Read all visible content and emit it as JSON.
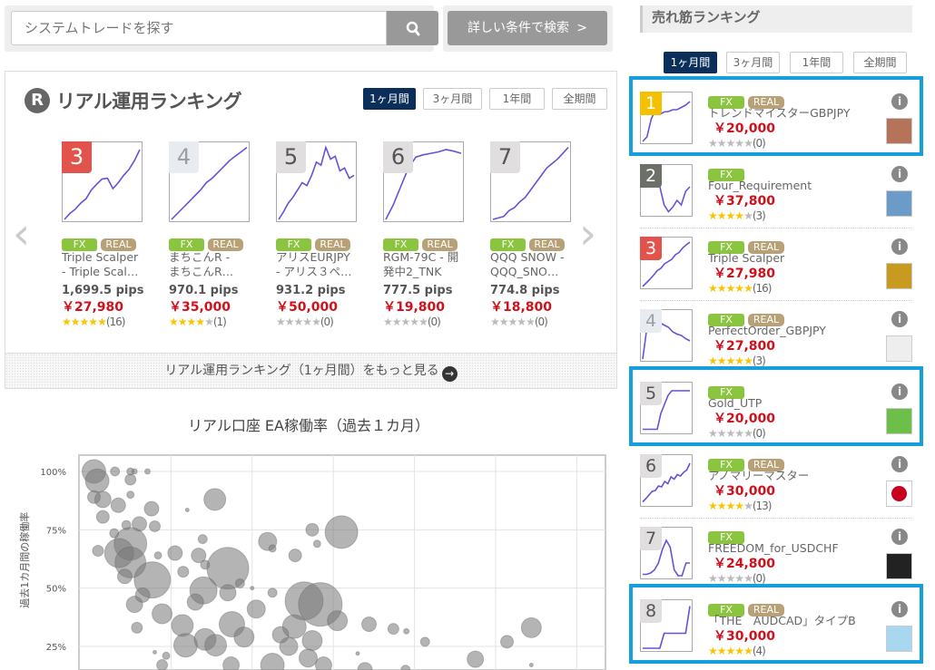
{
  "search": {
    "placeholder": "システムトレードを探す",
    "button_icon": "search-icon",
    "advanced_label": "詳しい条件で検索",
    "advanced_arrow": ">"
  },
  "real_ranking": {
    "icon_letter": "R",
    "title": "リアル運用ランキング",
    "tabs": [
      {
        "label": "1ヶ月間",
        "active": true
      },
      {
        "label": "3ヶ月間"
      },
      {
        "label": "1年間"
      },
      {
        "label": "全期間"
      }
    ],
    "cards": [
      {
        "rank": "3",
        "fx": "FX",
        "real": "REAL",
        "name1": "Triple Scalper",
        "name2": "- Triple Scal…",
        "pips": "1,699.5 pips",
        "price": "￥27,980",
        "rating": 4.5,
        "reviews": "(16)",
        "rank_color": "#e2534b",
        "rank_text": "#fff",
        "sparkline": [
          0,
          8,
          14,
          22,
          28,
          40,
          48,
          55,
          56,
          42,
          50,
          60,
          68,
          80,
          95
        ]
      },
      {
        "rank": "4",
        "fx": "FX",
        "real": "REAL",
        "name1": "まちこんR -",
        "name2": "まちこんR…",
        "pips": "970.1 pips",
        "price": "￥35,000",
        "rating": 4,
        "reviews": "(1)",
        "rank_color": "#e8ebef",
        "rank_text": "#9aa0a8",
        "sparkline": [
          0,
          8,
          16,
          24,
          32,
          40,
          50,
          56,
          64,
          72,
          80,
          86,
          92,
          98
        ]
      },
      {
        "rank": "5",
        "fx": "FX",
        "real": "REAL",
        "name1": "アリスEURJPY",
        "name2": "- アリス３ペ…",
        "pips": "931.2 pips",
        "price": "￥50,000",
        "rating": 0,
        "reviews": "(0)",
        "rank_color": "#e0dede",
        "rank_text": "#555",
        "sparkline": [
          0,
          10,
          22,
          30,
          40,
          50,
          46,
          60,
          78,
          74,
          98,
          82,
          86,
          66,
          70,
          56,
          60
        ]
      },
      {
        "rank": "6",
        "fx": "FX",
        "real": "REAL",
        "name1": "RGM-79C - 開",
        "name2": "発中2_TNK",
        "pips": "777.5 pips",
        "price": "￥19,800",
        "rating": 0,
        "reviews": "(0)",
        "rank_color": "#e0dede",
        "rank_text": "#555",
        "sparkline": [
          0,
          20,
          45,
          70,
          85,
          88,
          90,
          92,
          95,
          93,
          90
        ]
      },
      {
        "rank": "7",
        "fx": "FX",
        "real": "REAL",
        "name1": "QQQ SNOW -",
        "name2": "QQQ_SNO…",
        "pips": "774.8 pips",
        "price": "￥18,800",
        "rating": 0,
        "reviews": "(0)",
        "rank_color": "#e0dede",
        "rank_text": "#555",
        "sparkline": [
          0,
          2,
          4,
          12,
          16,
          24,
          30,
          40,
          50,
          60,
          70,
          76,
          82,
          90,
          98
        ]
      }
    ],
    "prev_arrow": "‹",
    "next_arrow": "›",
    "more_link": "リアル運用ランキング（1ヶ月間）をもっと見る",
    "more_icon": "→"
  },
  "sales_ranking": {
    "title": "売れ筋ランキング",
    "tabs": [
      {
        "label": "1ヶ月間",
        "active": true
      },
      {
        "label": "3ヶ月間"
      },
      {
        "label": "1年間"
      },
      {
        "label": "全期間"
      }
    ],
    "info_label": "i",
    "items": [
      {
        "rank": "1",
        "fx": "FX",
        "real": "REAL",
        "name": "トレンドマイスターGBPJPY",
        "price": "￥20,000",
        "rating": 0,
        "reviews": "(0)",
        "highlighted": true,
        "rank_color": "#f5c000",
        "rank_text": "#fff",
        "img_color": "#b5735a",
        "sparkline": [
          0,
          10,
          50,
          70,
          60,
          65,
          66,
          70,
          70,
          75,
          80,
          88
        ]
      },
      {
        "rank": "2",
        "fx": "FX",
        "real": "",
        "name": "Four_Requirement",
        "price": "￥37,800",
        "rating": 3.5,
        "reviews": "(3)",
        "highlighted": false,
        "rank_color": "#6d7069",
        "rank_text": "#fff",
        "img_color": "#6b9bc8",
        "sparkline": [
          95,
          80,
          72,
          78,
          60,
          20,
          5,
          15,
          30,
          20,
          50,
          60
        ]
      },
      {
        "rank": "3",
        "fx": "FX",
        "real": "REAL",
        "name": "Triple Scalper",
        "price": "￥27,980",
        "rating": 4.5,
        "reviews": "(16)",
        "highlighted": false,
        "rank_color": "#e2534b",
        "rank_text": "#fff",
        "img_color": "#c89a20",
        "sparkline": [
          0,
          8,
          16,
          25,
          35,
          40,
          50,
          55,
          60,
          70,
          75,
          85,
          92,
          98
        ]
      },
      {
        "rank": "4",
        "fx": "FX",
        "real": "REAL",
        "name": "PerfectOrder_GBPJPY",
        "price": "￥27,800",
        "rating": 5,
        "reviews": "(3)",
        "highlighted": false,
        "rank_color": "#e8ebef",
        "rank_text": "#9aa0a8",
        "img_color": "#eeeeee",
        "sparkline": [
          0,
          70,
          70,
          95,
          80,
          75,
          70,
          60,
          55,
          52,
          45,
          40
        ]
      },
      {
        "rank": "5",
        "fx": "FX",
        "real": "",
        "name": "Gold_UTP",
        "price": "￥20,000",
        "rating": 0,
        "reviews": "(0)",
        "highlighted": true,
        "rank_color": "#e0dede",
        "rank_text": "#555",
        "img_color": "#6cc04a",
        "sparkline": [
          5,
          5,
          5,
          5,
          5,
          40,
          60,
          80,
          90,
          90,
          90,
          90,
          90,
          90
        ]
      },
      {
        "rank": "6",
        "fx": "FX",
        "real": "REAL",
        "name": "アノマリーマスター",
        "price": "￥30,000",
        "rating": 4,
        "reviews": "(13)",
        "highlighted": false,
        "rank_color": "#e0dede",
        "rank_text": "#555",
        "img_color": "#ffffff",
        "sparkline": [
          5,
          12,
          20,
          28,
          30,
          40,
          38,
          50,
          45,
          60,
          55,
          65,
          62,
          70,
          75,
          90
        ]
      },
      {
        "rank": "7",
        "fx": "FX",
        "real": "",
        "name": "FREEDOM_for_USDCHF",
        "price": "￥24,800",
        "rating": 0,
        "reviews": "(0)",
        "highlighted": false,
        "rank_color": "#e0dede",
        "rank_text": "#555",
        "img_color": "#222222",
        "sparkline": [
          5,
          5,
          8,
          15,
          30,
          60,
          80,
          65,
          15,
          2,
          2,
          30,
          30
        ]
      },
      {
        "rank": "8",
        "fx": "FX",
        "real": "REAL",
        "name": "「THE　AUDCAD」タイプB",
        "price": "￥30,000",
        "rating": 5,
        "reviews": "(4)",
        "highlighted": true,
        "rank_color": "#e0dede",
        "rank_text": "#555",
        "img_color": "#a8d8f0",
        "sparkline": [
          2,
          2,
          2,
          2,
          2,
          35,
          35,
          35,
          35,
          35,
          35,
          95
        ]
      }
    ]
  },
  "chart_data": {
    "type": "scatter",
    "subtype": "bubble",
    "title": "リアル口座 EA稼働率（過去１カ月）",
    "xlabel": "",
    "ylabel": "過去1カ月間の稼働率",
    "yticks": [
      "100%",
      "75%",
      "50%",
      "25%"
    ],
    "ytick_values": [
      100,
      75,
      50,
      25
    ],
    "grid": true,
    "xlim": [
      0,
      6.3
    ],
    "ylim_visible": [
      13,
      107
    ],
    "color": "#777777",
    "bubbles": [
      [
        0.05,
        100,
        13
      ],
      [
        0.09,
        96,
        13
      ],
      [
        0.31,
        100,
        5
      ],
      [
        0.5,
        100,
        4
      ],
      [
        0.55,
        100,
        3
      ],
      [
        0.71,
        100,
        3
      ],
      [
        0.5,
        96.5,
        6
      ],
      [
        0.5,
        90,
        4
      ],
      [
        0.16,
        88,
        9
      ],
      [
        0.05,
        89,
        7
      ],
      [
        0.35,
        85.5,
        8
      ],
      [
        0.16,
        80.5,
        7
      ],
      [
        0.76,
        84,
        8
      ],
      [
        1.2,
        83.5,
        2
      ],
      [
        1.54,
        88,
        12
      ],
      [
        0.45,
        77,
        5
      ],
      [
        0.61,
        77.5,
        8
      ],
      [
        0.8,
        76.5,
        6
      ],
      [
        0.3,
        73.5,
        5
      ],
      [
        0.5,
        69,
        18
      ],
      [
        0.36,
        65,
        16
      ],
      [
        0.5,
        61,
        17
      ],
      [
        0.77,
        53.5,
        20
      ],
      [
        0.84,
        64,
        4
      ],
      [
        0.43,
        55,
        8
      ],
      [
        0.55,
        43,
        9
      ],
      [
        0.58,
        33,
        6
      ],
      [
        0.89,
        39,
        11
      ],
      [
        1.05,
        65,
        8
      ],
      [
        1.15,
        57,
        6
      ],
      [
        1.39,
        71,
        5
      ],
      [
        1.34,
        64,
        8
      ],
      [
        1.42,
        60,
        5
      ],
      [
        1.7,
        58.5,
        23
      ],
      [
        1.85,
        52,
        5
      ],
      [
        1.4,
        49,
        15
      ],
      [
        1.7,
        48,
        9
      ],
      [
        2.0,
        50,
        2
      ],
      [
        2.25,
        48,
        5
      ],
      [
        2.19,
        70,
        10
      ],
      [
        2.25,
        67,
        4
      ],
      [
        2.53,
        64,
        7
      ],
      [
        2.74,
        75,
        7
      ],
      [
        2.8,
        69,
        4
      ],
      [
        3.1,
        74,
        18
      ],
      [
        2.64,
        44.5,
        21
      ],
      [
        2.84,
        43,
        24
      ],
      [
        2.05,
        41,
        10
      ],
      [
        1.75,
        34.5,
        14
      ],
      [
        1.14,
        34,
        12
      ],
      [
        1.18,
        25.5,
        13
      ],
      [
        1.42,
        28,
        12
      ],
      [
        1.55,
        25.5,
        12
      ],
      [
        1.9,
        29,
        11
      ],
      [
        2.52,
        33.5,
        13
      ],
      [
        2.74,
        27.5,
        11
      ],
      [
        2.45,
        25,
        10
      ],
      [
        3.05,
        36,
        11
      ],
      [
        3.44,
        34.5,
        8
      ],
      [
        3.74,
        32.5,
        6
      ],
      [
        3.9,
        31.5,
        3
      ],
      [
        4.13,
        27,
        5
      ],
      [
        5.14,
        27,
        7
      ],
      [
        5.44,
        33,
        11
      ],
      [
        4.75,
        19.5,
        9
      ],
      [
        3.3,
        22,
        2
      ],
      [
        2.25,
        17,
        13
      ],
      [
        2.69,
        20,
        10
      ],
      [
        2.88,
        17,
        9
      ],
      [
        0.89,
        17,
        6
      ],
      [
        1.74,
        17,
        9
      ],
      [
        3.39,
        15,
        8
      ],
      [
        3.89,
        15,
        5
      ],
      [
        5.44,
        17,
        2
      ],
      [
        0.94,
        21,
        4
      ],
      [
        0.8,
        22.5,
        2
      ],
      [
        0.1,
        66,
        6
      ],
      [
        0.65,
        47,
        8
      ],
      [
        1.3,
        44,
        9
      ],
      [
        2.35,
        30,
        9
      ]
    ]
  }
}
